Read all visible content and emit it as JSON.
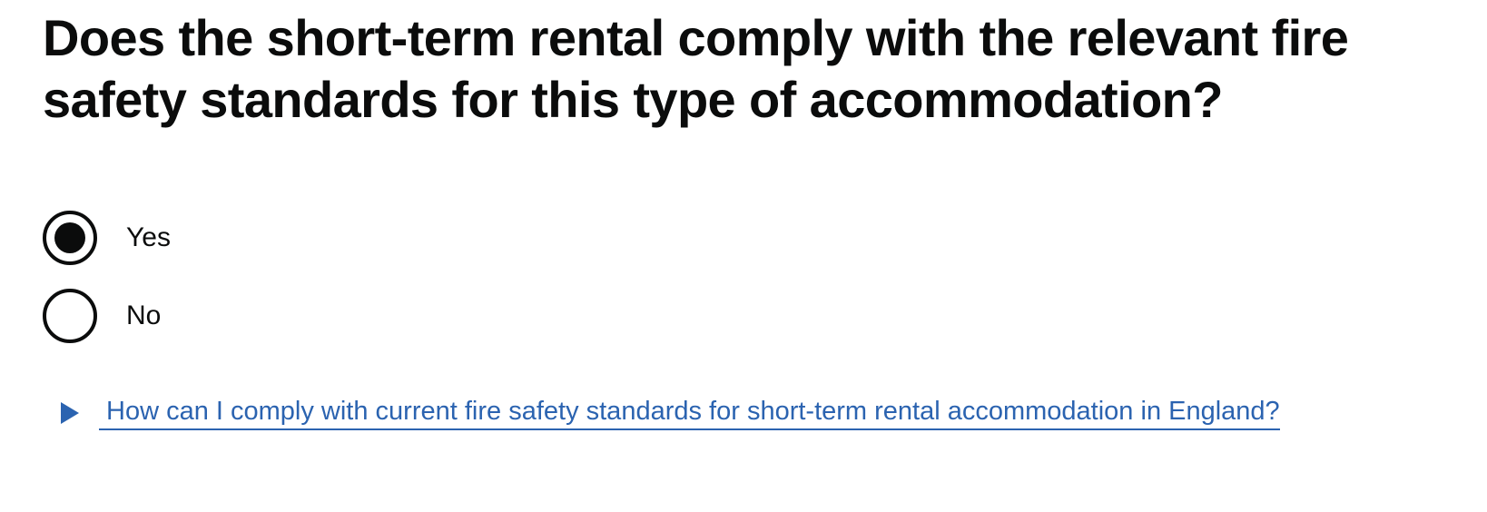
{
  "question": {
    "heading": "Does the short-term rental comply with the relevant fire safety standards for this type of accommodation?"
  },
  "options": [
    {
      "label": "Yes",
      "checked": true
    },
    {
      "label": "No",
      "checked": false
    }
  ],
  "details": {
    "summary": "How can I comply with current fire safety standards for short-term rental accommodation in England?",
    "icon": "triangle-right-icon"
  },
  "colors": {
    "text": "#0b0c0c",
    "link": "#2b63b0"
  }
}
